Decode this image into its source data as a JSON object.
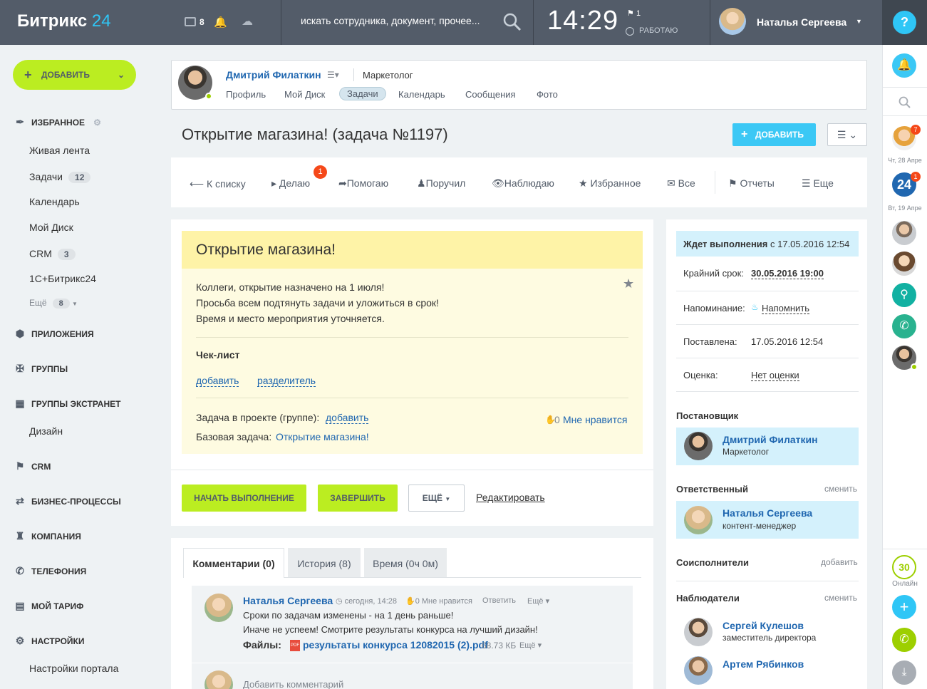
{
  "header": {
    "logo_main": "Битрикс",
    "logo_num": "24",
    "chat_count": "8",
    "search_placeholder": "искать сотрудника, документ, прочее...",
    "time": "14:29",
    "flag_count": "1",
    "work_status": "РАБОТАЮ",
    "user_name": "Наталья Сергеева",
    "help": "?"
  },
  "left_menu": {
    "add_button": "ДОБАВИТЬ",
    "favorites": "ИЗБРАННОЕ",
    "items": [
      {
        "label": "Живая лента",
        "count": ""
      },
      {
        "label": "Задачи",
        "count": "12"
      },
      {
        "label": "Календарь",
        "count": ""
      },
      {
        "label": "Мой Диск",
        "count": ""
      },
      {
        "label": "CRM",
        "count": "3"
      },
      {
        "label": "1С+Битрикс24",
        "count": ""
      }
    ],
    "more_label": "Ещё",
    "more_count": "8",
    "sections": {
      "apps": "ПРИЛОЖЕНИЯ",
      "groups": "ГРУППЫ",
      "extranet": "ГРУППЫ ЭКСТРАНЕТ",
      "extranet_item": "Дизайн",
      "crm": "CRM",
      "bp": "БИЗНЕС-ПРОЦЕССЫ",
      "company": "КОМПАНИЯ",
      "telephony": "ТЕЛЕФОНИЯ",
      "tariff": "МОЙ ТАРИФ",
      "settings": "НАСТРОЙКИ",
      "settings_item": "Настройки портала"
    }
  },
  "profile": {
    "name": "Дмитрий Филаткин",
    "position": "Маркетолог",
    "tabs": [
      "Профиль",
      "Мой Диск",
      "Задачи",
      "Календарь",
      "Сообщения",
      "Фото"
    ]
  },
  "task": {
    "page_title": "Открытие магазина! (задача №1197)",
    "add_button": "ДОБАВИТЬ",
    "title": "Открытие магазина!",
    "desc": [
      "Коллеги, открытие назначено на 1 июля!",
      "Просьба всем подтянуть задачи и уложиться в срок!",
      "Время и место мероприятия уточняется."
    ],
    "checklist_label": "Чек-лист",
    "checklist_add": "добавить",
    "checklist_sep": "разделитель",
    "project_label": "Задача в проекте (группе):",
    "project_add": "добавить",
    "base_label": "Базовая задача:",
    "base_link": "Открытие магазина!",
    "like_count": "0",
    "like_label": "Мне нравится",
    "btn_start": "НАЧАТЬ ВЫПОЛНЕНИЕ",
    "btn_finish": "ЗАВЕРШИТЬ",
    "btn_more": "ЕЩЁ",
    "btn_edit": "Редактировать"
  },
  "filters": {
    "back": "К списку",
    "doing": "Делаю",
    "doing_badge": "1",
    "helping": "Помогаю",
    "assigned": "Поручил",
    "watching": "Наблюдаю",
    "favorite": "Избранное",
    "all": "Все",
    "reports": "Отчеты",
    "more": "Еще"
  },
  "comments": {
    "tabs": [
      "Комментарии (0)",
      "История (8)",
      "Время (0ч 0м)"
    ],
    "author": "Наталья Сергеева",
    "time": "сегодня, 14:28",
    "likes": "0 Мне нравится",
    "reply": "Ответить",
    "more": "Ещё",
    "lines": [
      "Сроки по задачам изменены - на 1 день раньше!",
      "Иначе не успеем! Смотрите результаты конкурса на лучший дизайн!"
    ],
    "files_label": "Файлы:",
    "file_name": "результаты конкурса 12082015 (2).pdf",
    "file_size": "68.73 КБ",
    "file_more": "Ещё",
    "add_placeholder": "Добавить комментарий"
  },
  "side": {
    "status_bold": "Ждет выполнения",
    "status_rest": "с 17.05.2016 12:54",
    "deadline_label": "Крайний срок:",
    "deadline_value": "30.05.2016 19:00",
    "remind_label": "Напоминание:",
    "remind_value": "Напомнить",
    "created_label": "Поставлена:",
    "created_value": "17.05.2016 12:54",
    "rating_label": "Оценка:",
    "rating_value": "Нет оценки",
    "creator_hdr": "Постановщик",
    "creator_name": "Дмитрий Филаткин",
    "creator_pos": "Маркетолог",
    "resp_hdr": "Ответственный",
    "resp_change": "сменить",
    "resp_name": "Наталья Сергеева",
    "resp_pos": "контент-менеджер",
    "coexec_hdr": "Соисполнители",
    "coexec_add": "добавить",
    "watch_hdr": "Наблюдатели",
    "watch_change": "сменить",
    "watcher1_name": "Сергей Кулешов",
    "watcher1_pos": "заместитель директора",
    "watcher2_name": "Артем Рябинков"
  },
  "right_bar": {
    "badge1": "7",
    "date1": "Чт, 28 Апре",
    "badge2": "1",
    "date2": "Вт, 19 Апре",
    "online_count": "30",
    "online_label": "Онлайн",
    "logo24": "24"
  }
}
